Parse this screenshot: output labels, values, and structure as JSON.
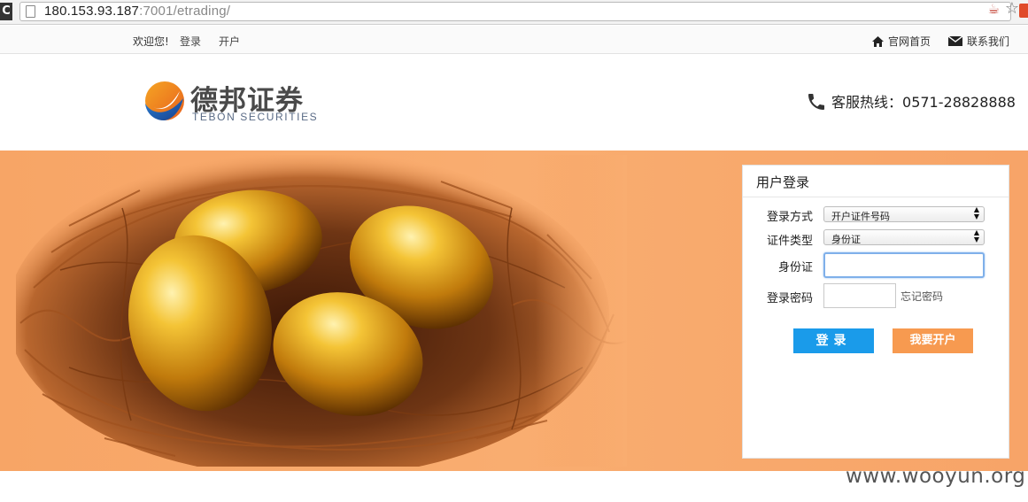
{
  "browser": {
    "url_host": "180.153.93.187",
    "url_rest": ":7001/etrading/",
    "reload_glyph": "C"
  },
  "topbar": {
    "welcome": "欢迎您!",
    "login_link": "登录",
    "open_account_link": "开户",
    "home_link": "官网首页",
    "contact_link": "联系我们"
  },
  "header": {
    "logo_cn": "德邦证券",
    "logo_en": "TEBON  SECURITIES",
    "hotline_label": "客服热线：",
    "hotline_number": "0571-28828888"
  },
  "login": {
    "title": "用户登录",
    "method_label": "登录方式",
    "method_value": "开户证件号码",
    "id_type_label": "证件类型",
    "id_type_value": "身份证",
    "id_label": "身份证",
    "id_value": "",
    "password_label": "登录密码",
    "forgot_link": "忘记密码",
    "login_button": "登录",
    "open_button": "我要开户"
  },
  "watermark": "www.wooyun.org",
  "colors": {
    "banner_orange": "#f9ad70",
    "login_blue": "#1a9bea",
    "open_orange": "#f79a50"
  }
}
